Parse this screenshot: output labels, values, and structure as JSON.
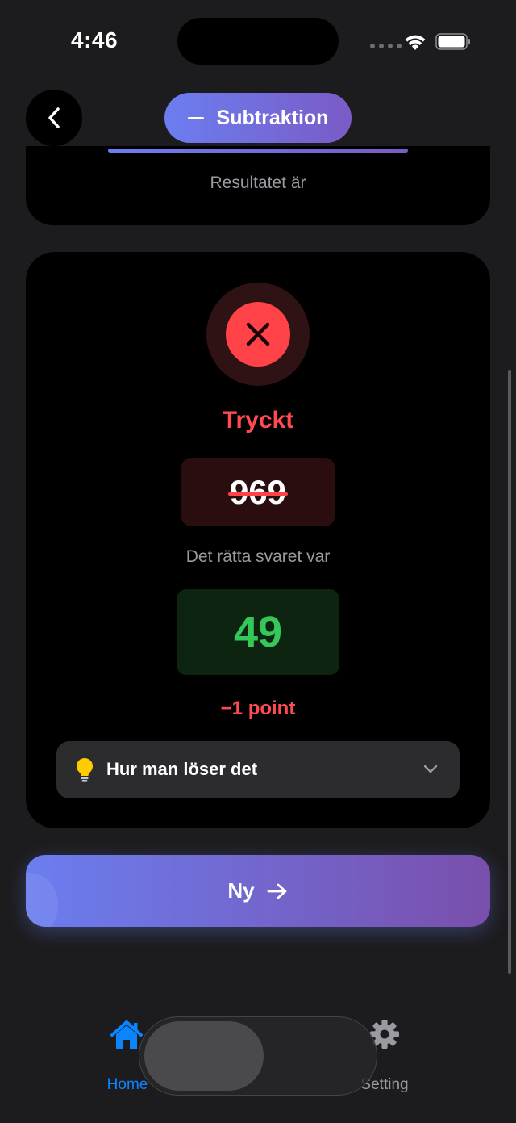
{
  "status_bar": {
    "time": "4:46"
  },
  "header": {
    "mode_label": "Subtraktion"
  },
  "question": {
    "result_label": "Resultatet är",
    "progress": 1.0
  },
  "feedback": {
    "status": "Tryckt",
    "user_answer": "969",
    "correct_answer_label": "Det rätta svaret var",
    "correct_answer": "49",
    "points": "−1 point",
    "hint_label": "Hur man löser det"
  },
  "actions": {
    "next_label": "Ny"
  },
  "tab_bar": {
    "items": [
      {
        "label": "Home",
        "icon": "home-icon",
        "active": true
      },
      {
        "label": "Setting",
        "icon": "gear-icon",
        "active": false
      }
    ]
  },
  "colors": {
    "accent": "#0a84ff",
    "error": "#ff4348",
    "success": "#34c759",
    "gradient_start": "#6b7ef0",
    "gradient_end": "#7a5bc6"
  }
}
